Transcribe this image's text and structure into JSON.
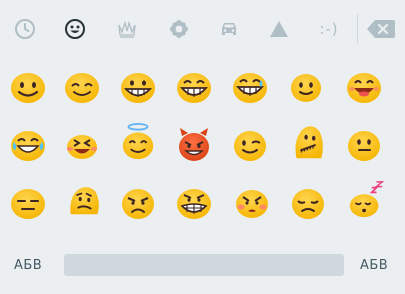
{
  "categories": [
    {
      "name": "recent",
      "icon": "clock-icon",
      "active": false
    },
    {
      "name": "faces",
      "icon": "smiley-icon",
      "active": true
    },
    {
      "name": "objects",
      "icon": "crown-icon",
      "active": false
    },
    {
      "name": "nature",
      "icon": "flower-icon",
      "active": false
    },
    {
      "name": "places",
      "icon": "car-icon",
      "active": false
    },
    {
      "name": "symbols",
      "icon": "triangle-icon",
      "active": false
    },
    {
      "name": "emoticons",
      "icon": "emoticon-text-icon",
      "text": ":-)",
      "active": false
    }
  ],
  "backspace_icon": "backspace-icon",
  "emoji_rows": [
    [
      "smiling-face",
      "smiling-eyes-face",
      "grinning-face",
      "grinning-smiling-eyes-face",
      "beaming-face",
      "slightly-smiling-face",
      "laughing-face"
    ],
    [
      "tears-of-joy-face",
      "squinting-laughing-face",
      "halo-face",
      "smiling-devil-face",
      "winking-face",
      "zipper-mouth-face",
      "neutral-face"
    ],
    [
      "expressionless-face",
      "confused-face",
      "angry-face",
      "grimacing-face",
      "pouting-face",
      "pensive-face",
      "sleeping-face"
    ]
  ],
  "bottom": {
    "left_label": "АБВ",
    "right_label": "АБВ"
  },
  "colors": {
    "emoji_yellow": "#f6c02c",
    "devil_red": "#e64a19",
    "accent": "#26a69a"
  }
}
